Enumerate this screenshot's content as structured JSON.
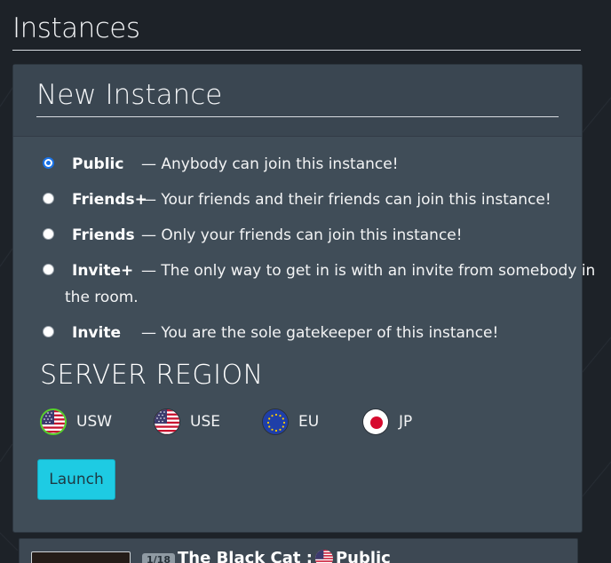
{
  "page": {
    "title": "Instances"
  },
  "new_instance": {
    "title": "New Instance",
    "options": [
      {
        "name": "Public",
        "desc": "— Anybody can join this instance!",
        "checked": true
      },
      {
        "name": "Friends+",
        "desc": "— Your friends and their friends can join this instance!",
        "checked": false
      },
      {
        "name": "Friends",
        "desc": "— Only your friends can join this instance!",
        "checked": false
      },
      {
        "name": "Invite+",
        "desc": "— The only way to get in is with an invite from somebody in",
        "desc2": "the room.",
        "checked": false
      },
      {
        "name": "Invite",
        "desc": "— You are the sole gatekeeper of this instance!",
        "checked": false
      }
    ],
    "region_title": "SERVER REGION",
    "regions": [
      {
        "label": "USW",
        "icon": "us-flag-icon",
        "selected": true
      },
      {
        "label": "USE",
        "icon": "us-flag-icon",
        "selected": false
      },
      {
        "label": "EU",
        "icon": "eu-flag-icon",
        "selected": false
      },
      {
        "label": "JP",
        "icon": "jp-flag-icon",
        "selected": false
      }
    ],
    "launch_label": "Launch"
  },
  "instance_card": {
    "badge": "1/18",
    "name": "The Black Cat :",
    "type": "Public",
    "flag_icon": "us-flag-icon"
  },
  "colors": {
    "accent": "#1ecbe3",
    "selected_region": "#56d12a",
    "radio_checked": "#1a73e8"
  }
}
